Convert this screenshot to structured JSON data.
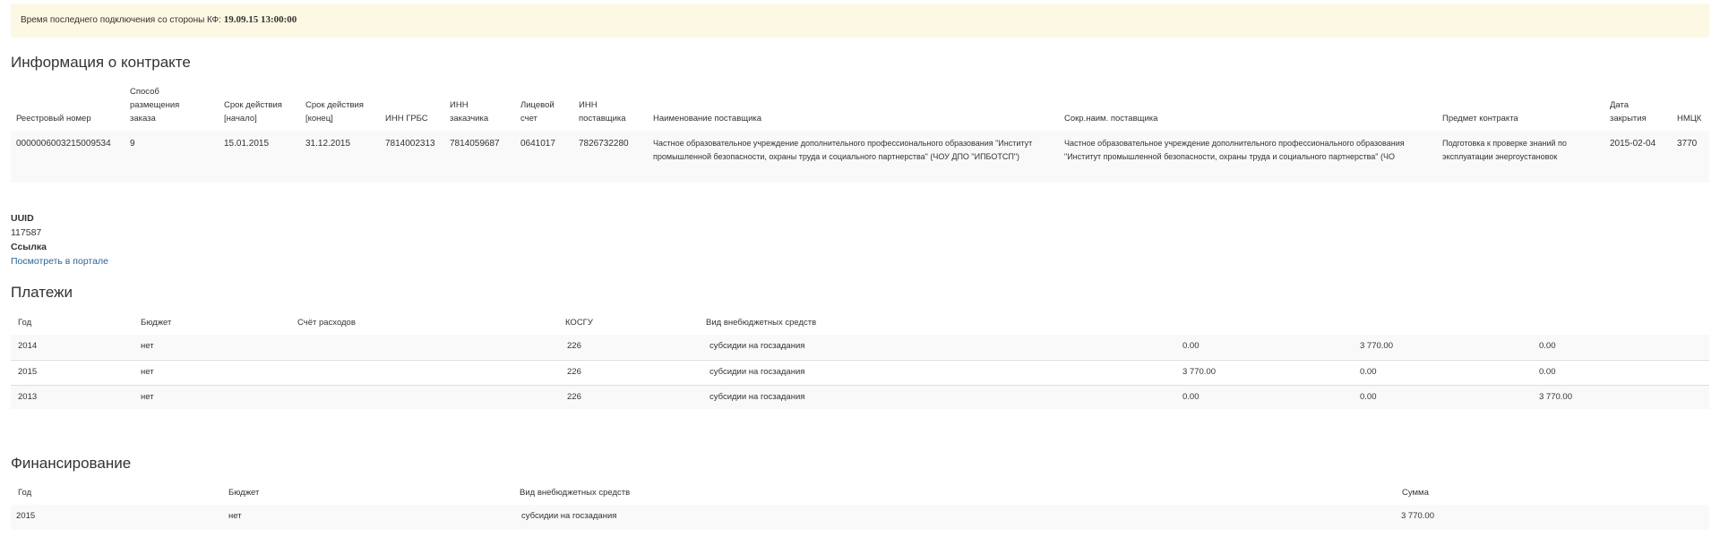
{
  "banner": {
    "label": "Время последнего подключения со стороны КФ:",
    "time": "19.09.15 13:00:00"
  },
  "contract": {
    "title": "Информация о контракте",
    "headers": {
      "reg": [
        "Реестровый номер"
      ],
      "method": [
        "Способ",
        "размещения",
        "заказа"
      ],
      "start": [
        "Срок действия",
        "[начало]"
      ],
      "end": [
        "Срок действия",
        "[конец]"
      ],
      "inn_grbs": [
        "ИНН ГРБС"
      ],
      "inn_cust": [
        "ИНН",
        "заказчика"
      ],
      "account": [
        "Лицевой",
        "счет"
      ],
      "inn_sup": [
        "ИНН",
        "поставщика"
      ],
      "sup_name": [
        "Наименование поставщика"
      ],
      "sup_short": [
        "Сокр.наим. поставщика"
      ],
      "subject": [
        "Предмет контракта"
      ],
      "close_date": [
        "Дата",
        "закрытия"
      ],
      "nmck": [
        "НМЦК"
      ]
    },
    "row": {
      "reg": "0000006003215009534",
      "method": "9",
      "start": "15.01.2015",
      "end": "31.12.2015",
      "inn_grbs": "7814002313",
      "inn_cust": "7814059687",
      "account": "0641017",
      "inn_sup": "7826732280",
      "sup_name": "Частное образовательное учреждение дополнительного профессионального образования \"Институт промышленной безопасности, охраны труда и социального партнерства\" (ЧОУ ДПО \"ИПБОТСП\")",
      "sup_short": "Частное образовательное учреждение дополнительного профессионального образования \"Институт промышленной безопасности, охраны труда и социального партнерства\" (ЧО",
      "subject": "Подготовка к проверке знаний по эксплуатации энергоустановок",
      "close_date": "2015-02-04",
      "nmck": "3770"
    }
  },
  "meta": {
    "uuid_label": "UUID",
    "uuid_value": "117587",
    "link_label": "Ссылка",
    "link_text": "Посмотреть в портале"
  },
  "payments": {
    "title": "Платежи",
    "headers": [
      "Год",
      "Бюджет",
      "Счёт расходов",
      "КОСГУ",
      "Вид внебюджетных средств"
    ],
    "rows": [
      {
        "year": "2014",
        "budget": "нет",
        "kosgu": "226",
        "kind": "субсидии на госзадания",
        "a": "0.00",
        "b": "3 770.00",
        "c": "0.00"
      },
      {
        "year": "2015",
        "budget": "нет",
        "kosgu": "226",
        "kind": "субсидии на госзадания",
        "a": "3 770.00",
        "b": "0.00",
        "c": "0.00"
      },
      {
        "year": "2013",
        "budget": "нет",
        "kosgu": "226",
        "kind": "субсидии на госзадания",
        "a": "0.00",
        "b": "0.00",
        "c": "3 770.00"
      }
    ]
  },
  "financing": {
    "title": "Финансирование",
    "headers": [
      "Год",
      "Бюджет",
      "Вид внебюджетных средств",
      "Сумма"
    ],
    "rows": [
      {
        "year": "2015",
        "budget": "нет",
        "kind": "субсидии на госзадания",
        "sum": "3 770.00"
      }
    ]
  }
}
